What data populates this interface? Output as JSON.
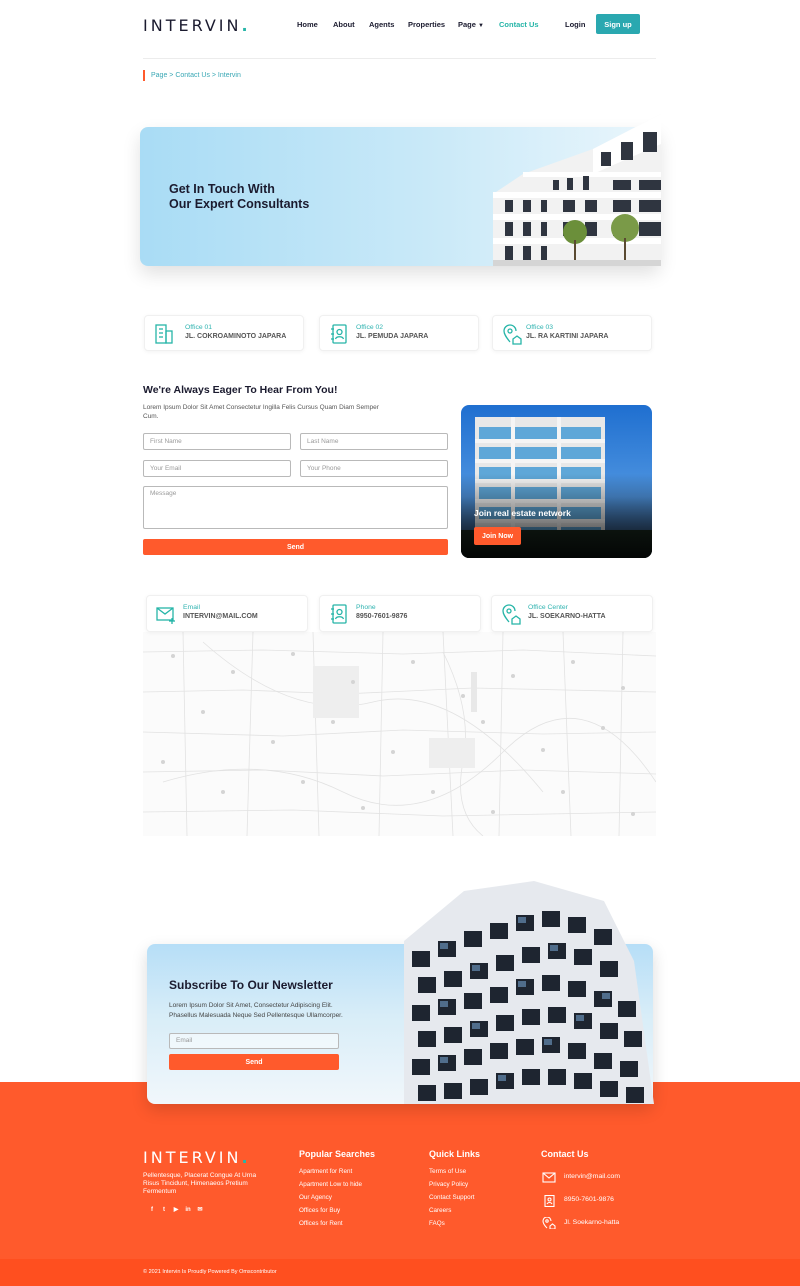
{
  "brand": {
    "name": "INTERVIN",
    "dot": "."
  },
  "nav": {
    "items": [
      "Home",
      "About",
      "Agents",
      "Properties",
      "Page",
      "Contact Us"
    ],
    "login": "Login",
    "signup": "Sign up"
  },
  "breadcrumb": "Page > Contact Us > Intervin",
  "hero": {
    "title_line1": "Get In Touch With",
    "title_line2": "Our Expert Consultants"
  },
  "offices": [
    {
      "label": "Office 01",
      "value": "JL. COKROAMINOTO JAPARA",
      "icon": "building-icon"
    },
    {
      "label": "Office 02",
      "value": "JL. PEMUDA JAPARA",
      "icon": "contact-book-icon"
    },
    {
      "label": "Office 03",
      "value": "JL. RA KARTINI JAPARA",
      "icon": "location-home-icon"
    }
  ],
  "form": {
    "title": "We're Always Eager To Hear From You!",
    "description": "Lorem Ipsum Dolor Sit Amet Consectetur Ingilla Felis Cursus Quam Diam Semper Cum.",
    "first_name": "First Name",
    "last_name": "Last Name",
    "email": "Your Email",
    "phone": "Your Phone",
    "message": "Message",
    "send": "Send"
  },
  "promo": {
    "text": "Join real estate network",
    "button": "Join Now"
  },
  "contacts": [
    {
      "label": "Email",
      "value": "INTERVIN@MAIL.COM",
      "icon": "mail-icon"
    },
    {
      "label": "Phone",
      "value": "8950-7601-9876",
      "icon": "contact-book-icon"
    },
    {
      "label": "Office Center",
      "value": "JL. SOEKARNO-HATTA",
      "icon": "location-home-icon"
    }
  ],
  "newsletter": {
    "title": "Subscribe To Our Newsletter",
    "description": "Lorem Ipsum Dolor Sit Amet, Consectetur Adipiscing Elit. Phasellus Malesuada Neque Sed Pellentesque Ullamcorper.",
    "email_placeholder": "Email",
    "send": "Send"
  },
  "footer": {
    "about": "Pellentesque, Placerat Congue At Urna Risus Tincidunt, Himenaeos Pretium Fermentum",
    "popular_title": "Popular Searches",
    "popular": [
      "Apartment for Rent",
      "Apartment Low to hide",
      "Our Agency",
      "Offices for Buy",
      "Offices for Rent"
    ],
    "quick_title": "Quick Links",
    "quick": [
      "Terms of Use",
      "Privacy Policy",
      "Contact Support",
      "Careers",
      "FAQs"
    ],
    "contact_title": "Contact Us",
    "contact_email": "intervin@mail.com",
    "contact_phone": "8950-7601-9876",
    "contact_address": "Jl. Soekarno-hatta",
    "copyright": "© 2021 Intervin Is Proudly Powered By Omscontributor"
  },
  "colors": {
    "accent": "#ff5a2c",
    "teal": "#26b5a8"
  }
}
